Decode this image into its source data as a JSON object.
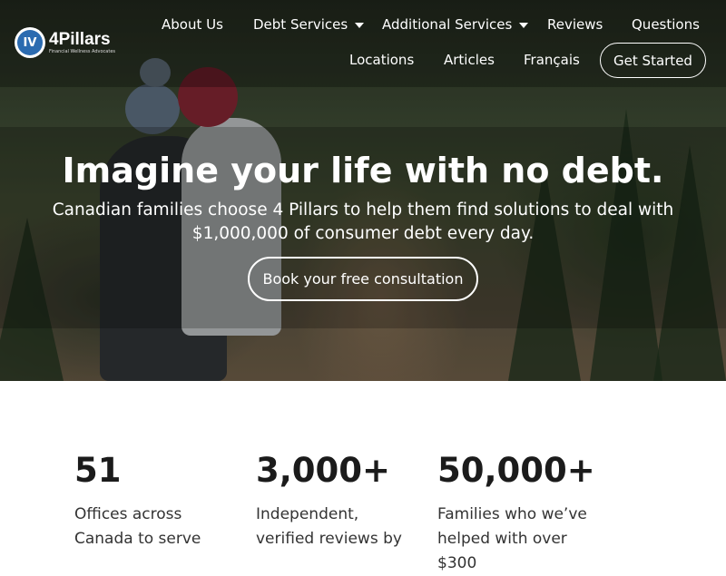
{
  "brand": {
    "name": "4Pillars",
    "tagline": "Financial Wellness Advocates",
    "mark": "IV"
  },
  "nav": {
    "about": "About Us",
    "debt_services": "Debt Services",
    "additional_services": "Additional Services",
    "reviews": "Reviews",
    "questions": "Questions",
    "locations": "Locations",
    "articles": "Articles",
    "francais": "Français",
    "get_started": "Get Started"
  },
  "hero": {
    "headline": "Imagine your life with no debt.",
    "subheadline": "Canadian families choose 4 Pillars to help them find solutions to deal with $1,000,000 of consumer debt every day.",
    "cta": "Book your free consultation"
  },
  "stats": [
    {
      "value": "51",
      "description": "Offices across Canada to serve"
    },
    {
      "value": "3,000+",
      "description": "Independent, verified reviews by"
    },
    {
      "value": "50,000+",
      "description": "Families who we’ve helped with over $300"
    }
  ],
  "colors": {
    "brand_blue": "#2b6bb0",
    "text_dark": "#1b1b1b",
    "white": "#ffffff"
  },
  "icons": {
    "dropdown": "chevron-down-icon"
  }
}
